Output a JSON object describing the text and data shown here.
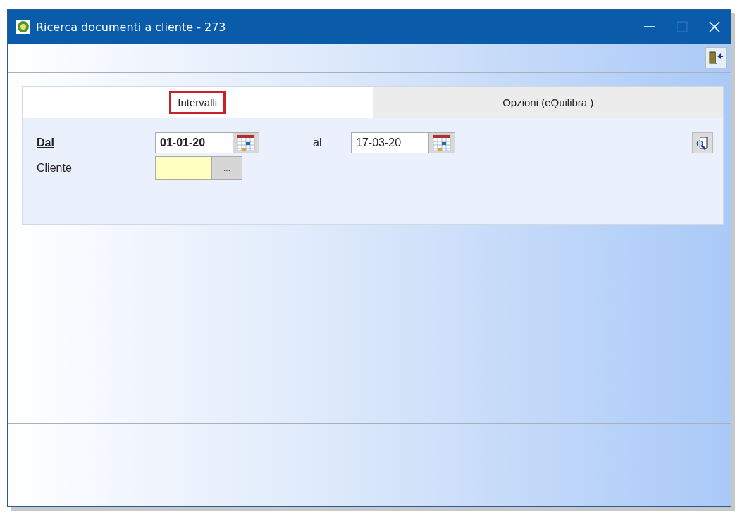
{
  "window": {
    "title": "Ricerca documenti a cliente - 273"
  },
  "tabs": [
    {
      "label": "Intervalli",
      "selected": true,
      "highlighted": true
    },
    {
      "label": "Opzioni (eQuilibra )",
      "selected": false,
      "highlighted": false
    }
  ],
  "form": {
    "from_label": "Dal",
    "from_value": "01-01-20",
    "to_label": "al",
    "to_value": "17-03-20",
    "client_label": "Cliente",
    "client_button": "..."
  }
}
